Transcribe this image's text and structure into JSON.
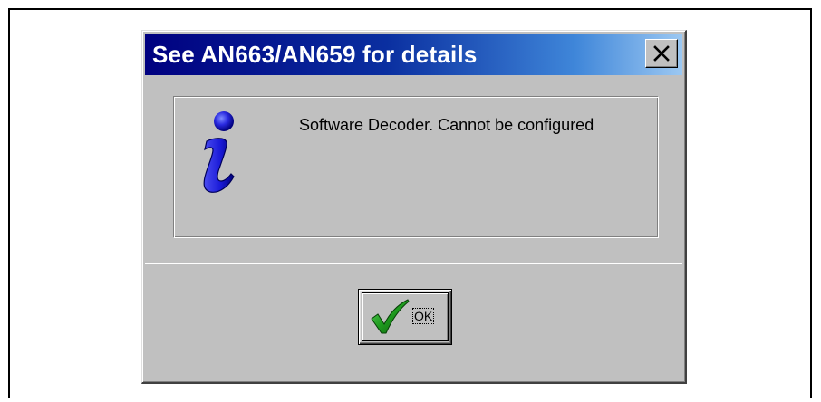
{
  "dialog": {
    "title": "See AN663/AN659 for details",
    "close_label": "×",
    "message": "Software Decoder.  Cannot be configured",
    "info_icon": "info-icon",
    "ok_button": {
      "label": "OK",
      "icon": "checkmark-icon"
    }
  },
  "colors": {
    "title_gradient_start": "#000080",
    "title_gradient_end": "#9cc8f2",
    "dialog_face": "#c0c0c0",
    "info_icon_blue": "#1a1ad8",
    "checkmark_green": "#1e9a1e"
  }
}
